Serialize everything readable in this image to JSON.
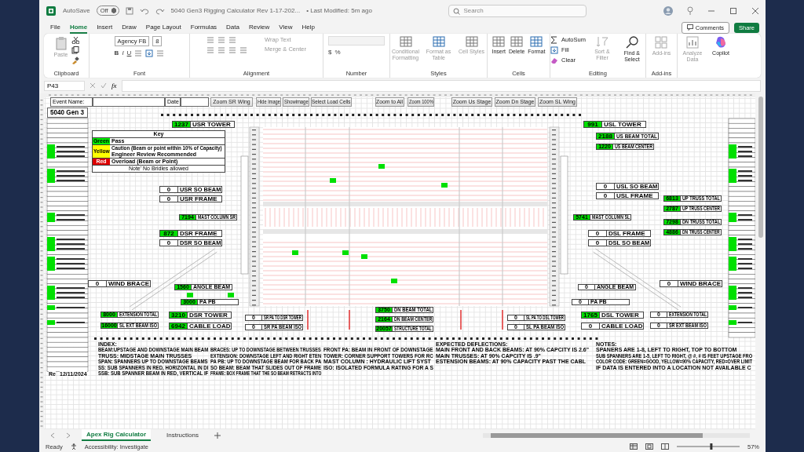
{
  "title_bar": {
    "autosave_label": "AutoSave",
    "autosave_state": "Off",
    "file_name": "5040 Gen3 Rigging Calculator Rev 1-17-202...",
    "modified": "• Last Modified: 5m ago",
    "search": {
      "placeholder": "Search"
    }
  },
  "menu": [
    {
      "label": "File",
      "selected": false
    },
    {
      "label": "Home",
      "selected": true
    },
    {
      "label": "Insert",
      "selected": false
    },
    {
      "label": "Draw",
      "selected": false
    },
    {
      "label": "Page Layout",
      "selected": false
    },
    {
      "label": "Formulas",
      "selected": false
    },
    {
      "label": "Data",
      "selected": false
    },
    {
      "label": "Review",
      "selected": false
    },
    {
      "label": "View",
      "selected": false
    },
    {
      "label": "Help",
      "selected": false
    }
  ],
  "comments_button": "Comments",
  "share_button": "Share",
  "ribbon": {
    "clipboard": {
      "paste": {
        "label": "Paste",
        "disabled": true
      },
      "label": "Clipboard"
    },
    "font": {
      "name": "Agency FB",
      "size": "8",
      "styles": [
        "B",
        "I",
        "U"
      ],
      "label": "Font"
    },
    "alignment": {
      "wrap": {
        "label": "Wrap Text",
        "disabled": true
      },
      "merge": {
        "label": "Merge & Center",
        "disabled": true
      },
      "label": "Alignment"
    },
    "number": {
      "symbols": [
        "$",
        "%"
      ],
      "label": "Number"
    },
    "styles": {
      "buttons": [
        {
          "label": "Conditional Formatting",
          "disabled": true
        },
        {
          "label": "Format as Table",
          "disabled": true
        },
        {
          "label": "Cell Styles",
          "disabled": true
        }
      ],
      "label": "Styles"
    },
    "cells": {
      "buttons": [
        {
          "label": "Insert",
          "disabled": false
        },
        {
          "label": "Delete",
          "disabled": false
        },
        {
          "label": "Format",
          "disabled": false
        }
      ],
      "label": "Cells"
    },
    "editing": {
      "autosum": "AutoSum",
      "fill": "Fill",
      "clear": "Clear",
      "buttons": [
        {
          "label": "Sort & Filter",
          "disabled": true
        },
        {
          "label": "Find & Select",
          "disabled": false
        }
      ],
      "label": "Editing"
    },
    "addins": {
      "button": {
        "label": "Add-ins",
        "disabled": true
      },
      "label": "Add-ins"
    },
    "extra": [
      {
        "label": "Analyze Data",
        "disabled": true
      },
      {
        "label": "Copilot",
        "disabled": false
      }
    ]
  },
  "formula_bar": {
    "name_box": "P43",
    "fx": "fx"
  },
  "sheet": {
    "event_label": "Event Name:",
    "date_label": "Date",
    "title": "5040 Gen 3",
    "header_buttons": [
      "Zoom SR Wing",
      "Hide Image",
      "Showimage",
      "Select Load Cells",
      "Zoom to All",
      "Zoom 100%",
      "Zoom Us Stage",
      "Zoom Dn Stage",
      "Zoom SL Wing"
    ],
    "key": {
      "title": "Key",
      "rows": [
        {
          "tag": "Green",
          "lines": [
            "Pass"
          ],
          "color": "#00ee00"
        },
        {
          "tag": "Yellow",
          "lines": [
            "Caution (Beam or point within 10% of Capacity)",
            "Engineer Review Recommended"
          ],
          "color": "#ffff00"
        },
        {
          "tag": "Red",
          "lines": [
            "Overload (Beam or Point)"
          ],
          "color": "#dd0000"
        }
      ],
      "note": "Note' No Bridles allowed"
    },
    "readings": [
      {
        "value": "1237",
        "label": "USR TOWER",
        "pass": true,
        "kind": "large"
      },
      {
        "value": "0",
        "label": "USR SO BEAM",
        "pass": false,
        "kind": "large"
      },
      {
        "value": "0",
        "label": "USR FRAME",
        "pass": false,
        "kind": "large"
      },
      {
        "value": "7194",
        "label": "MAST COLUMN SR",
        "pass": true,
        "kind": "small"
      },
      {
        "value": "872",
        "label": "DSR FRAME",
        "pass": true,
        "kind": "large"
      },
      {
        "value": "0",
        "label": "DSR SO BEAM",
        "pass": false,
        "kind": "large"
      },
      {
        "value": "0",
        "label": "WIND BRACE",
        "pass": false,
        "kind": "large"
      },
      {
        "value": "1560",
        "label": "ANGLE BEAM",
        "pass": true,
        "kind": "small"
      },
      {
        "value": "3000",
        "label": "PA PB",
        "pass": true,
        "kind": "small"
      },
      {
        "value": "8000",
        "label": "EXTENSION TOTAL",
        "pass": true,
        "kind": "small"
      },
      {
        "value": "16000",
        "label": "SL EXT BEAM ISO",
        "pass": true,
        "kind": "small"
      },
      {
        "value": "3210",
        "label": "DSR TOWER",
        "pass": true,
        "kind": "large"
      },
      {
        "value": "6942",
        "label": "CABLE LOAD",
        "pass": true,
        "kind": "large"
      },
      {
        "value": "0",
        "label": "SR PA TO DSR TOWER",
        "pass": false,
        "kind": "small"
      },
      {
        "value": "0",
        "label": "SR PA BEAM ISO",
        "pass": false,
        "kind": "small"
      },
      {
        "value": "3750",
        "label": "DN BEAM TOTAL",
        "pass": true,
        "kind": "small"
      },
      {
        "value": "2164",
        "label": "DN BEAM CENTER",
        "pass": true,
        "kind": "small"
      },
      {
        "value": "20057",
        "label": "STRUCTURE TOTAL",
        "pass": true,
        "kind": "small"
      },
      {
        "value": "0",
        "label": "SL PA TO DSL TOWER",
        "pass": false,
        "kind": "small"
      },
      {
        "value": "0",
        "label": "SL PA BEAM ISO",
        "pass": false,
        "kind": "small"
      },
      {
        "value": "991",
        "label": "USL TOWER",
        "pass": true,
        "kind": "large"
      },
      {
        "value": "2188",
        "label": "US BEAM TOTAL",
        "pass": true,
        "kind": "large"
      },
      {
        "value": "1220",
        "label": "US BEAM CENTER",
        "pass": true,
        "kind": "small"
      },
      {
        "value": "0",
        "label": "USL SO BEAM",
        "pass": false,
        "kind": "large"
      },
      {
        "value": "0",
        "label": "USL FRAME",
        "pass": false,
        "kind": "large"
      },
      {
        "value": "6813",
        "label": "UP TRUSS TOTAL",
        "pass": true,
        "kind": "small"
      },
      {
        "value": "2787",
        "label": "UP TRUSS CENTER",
        "pass": true,
        "kind": "small"
      },
      {
        "value": "5741",
        "label": "MAST COLUMN SL",
        "pass": true,
        "kind": "small"
      },
      {
        "value": "7298",
        "label": "DN TRUSS TOTAL",
        "pass": true,
        "kind": "small"
      },
      {
        "value": "4886",
        "label": "DN TRUSS CENTER",
        "pass": true,
        "kind": "small"
      },
      {
        "value": "0",
        "label": "DSL FRAME",
        "pass": false,
        "kind": "large"
      },
      {
        "value": "0",
        "label": "DSL SO BEAM",
        "pass": false,
        "kind": "large"
      },
      {
        "value": "0",
        "label": "ANGLE BEAM",
        "pass": false,
        "kind": "small"
      },
      {
        "value": "0",
        "label": "WIND BRACE",
        "pass": false,
        "kind": "large"
      },
      {
        "value": "0",
        "label": "PA PB",
        "pass": false,
        "kind": "small"
      },
      {
        "value": "1765",
        "label": "DSL TOWER",
        "pass": true,
        "kind": "large"
      },
      {
        "value": "0",
        "label": "CABLE LOAD",
        "pass": false,
        "kind": "large"
      },
      {
        "value": "0",
        "label": "EXTENSION TOTAL",
        "pass": false,
        "kind": "small"
      },
      {
        "value": "0",
        "label": "SR EXT BEAM ISO",
        "pass": false,
        "kind": "small"
      }
    ],
    "notes": [
      [
        "INDEX:",
        "BEAM:UPSTAGE AND DOWNSTAGE MAIN BEAM",
        "TRUSS: MIDSTAGE MAIN TRUSSES",
        "SPAN: SPANNERS UP TO DOWNSTAGE BEAMS",
        "SS:  SUB SPANNERS IN RED, HORIZONTAL IN DI",
        "SSB: SUB SPANNER BEAM IN RED, VERTICAL IF"
      ],
      [
        "BRACES: UP TO DOWNSTAGE BETWEEN TRUSSES",
        "EXTENSION: DOWNSTAGE LEFT AND RIGHT ETEN",
        "PA PB: UP TO DOWNSTAGE BEAM FOR BACK PA",
        "SO BEAM: BEAM THAT SLIDES OUT OF FRAME",
        "FRAME: BOX FRAME THAT THE SO BEAM RETRACTS INTO"
      ],
      [
        "FRONT PA: BEAM IN FRONT OF DOWNSTAGE",
        "TOWER: CORNER SUPPORT TOWERS FOR RC",
        "MAST COLUMN : HYDRAULIC LIFT SYST",
        "ISO: ISOLATED FORMULA RATING FOR A S"
      ],
      [
        "EXPECTED DEFLECTIONS:",
        "MAIN FRONT AND BACK BEAMS:  AT 90% CAPCITY IS 2.6\"",
        "MAIN TRUSSES: AT 90% CAPCITY IS .9\"",
        "ESTENSION BEAMS: AT 90% CAPACITY PAST THE CABL"
      ],
      [
        "NOTES:",
        "SPANERS ARE 1-8, LEFT TO RIGHT, TOP TO BOTTOM",
        "SUB SPANNERS ARE 1-5, LEFT TO RIGHT, @ #, # IS FEET UPSTAGE FRO",
        "COLOR CODE: GREEN=GOOD, YELLOW=90% CAPACITY, RED=OVER LIMIT",
        "IF DATA IS ENTERED INTO A LOCATION NOT AVAILABLE C"
      ]
    ],
    "revision": {
      "label": "Re",
      "date": "12/11/2024"
    }
  },
  "sheet_tabs": [
    {
      "label": "Apex Rig Calculator",
      "selected": true
    },
    {
      "label": "Instructions",
      "selected": false
    }
  ],
  "status_bar": {
    "mode": "Ready",
    "accessibility": "Accessibility: Investigate",
    "zoom_slider": {
      "level": 0.55
    },
    "zoom": "57%"
  }
}
